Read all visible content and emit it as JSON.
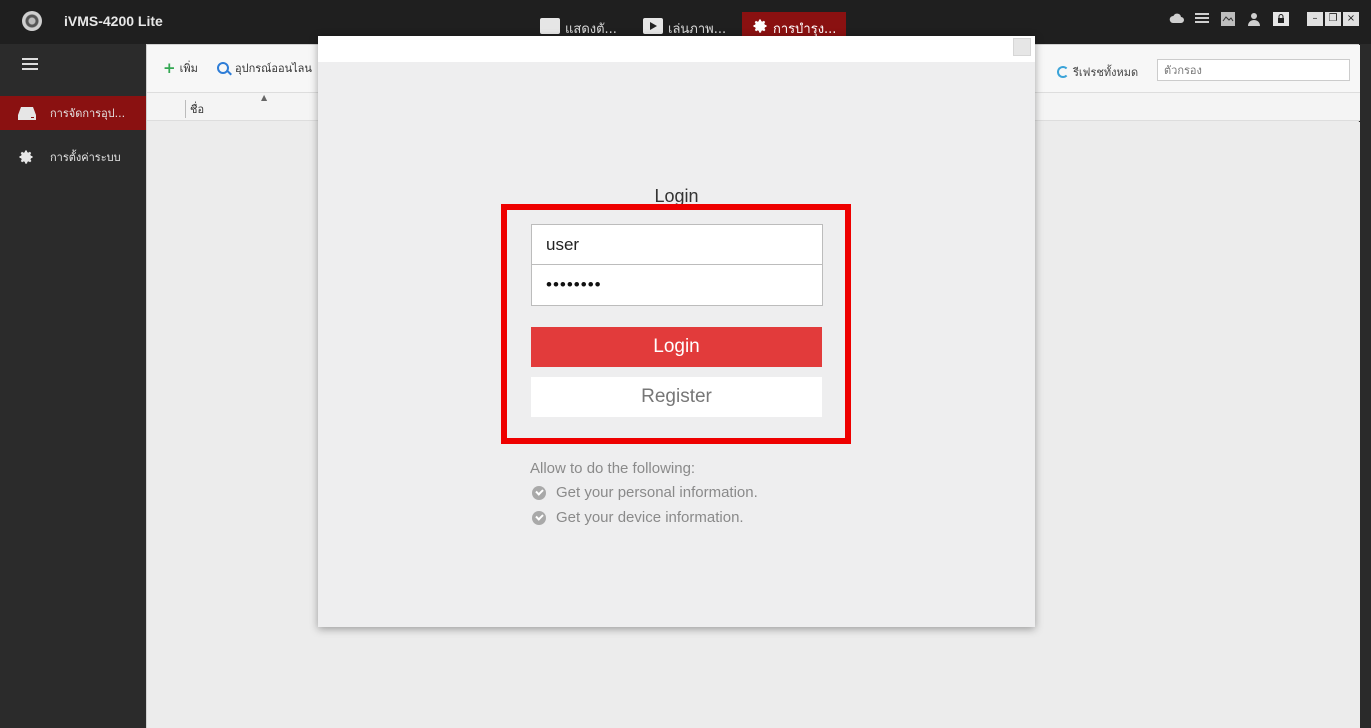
{
  "app": {
    "title": "iVMS-4200 Lite"
  },
  "top_tabs": [
    {
      "label": "แสดงตั...",
      "icon": "live-view-icon"
    },
    {
      "label": "เล่นภาพ...",
      "icon": "playback-icon"
    },
    {
      "label": "การบำรุง...",
      "icon": "gear-icon",
      "active": true
    }
  ],
  "sidebar": {
    "items": [
      {
        "label": "การจัดการอุป...",
        "icon": "device-icon",
        "active": true
      },
      {
        "label": "การตั้งค่าระบบ",
        "icon": "gear-icon"
      }
    ]
  },
  "toolbar": {
    "add_label": "เพิ่ม",
    "online_label": "อุปกรณ์ออนไลน",
    "refresh_all_label": "รีเฟรชทั้งหมด",
    "filter_placeholder": "ตัวกรอง"
  },
  "table": {
    "columns": [
      "ชื่อ"
    ]
  },
  "login_dialog": {
    "title": "Login",
    "username_value": "user",
    "password_value": "••••••••",
    "login_label": "Login",
    "register_label": "Register",
    "permissions_header": "Allow to do the following:",
    "permissions": [
      "Get your personal information.",
      "Get your device information."
    ]
  },
  "colors": {
    "accent_red": "#8a1111",
    "login_button": "#e23b3b",
    "highlight": "#ee0000"
  }
}
